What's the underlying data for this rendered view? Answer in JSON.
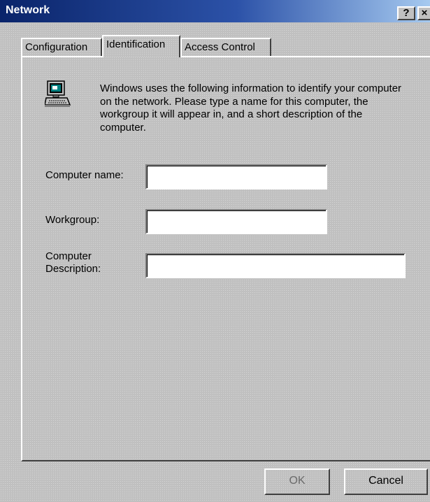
{
  "window": {
    "title": "Network",
    "help_label": "?",
    "close_label": "×"
  },
  "tabs": [
    {
      "label": "Configuration",
      "selected": false
    },
    {
      "label": "Identification",
      "selected": true
    },
    {
      "label": "Access Control",
      "selected": false
    }
  ],
  "identification": {
    "description": "Windows uses the following information to identify your computer on the network.  Please type a name for this computer, the workgroup it will appear in, and a short description of the computer.",
    "icon": "computer-icon",
    "fields": {
      "computer_name": {
        "label": "Computer name:",
        "value": ""
      },
      "workgroup": {
        "label": "Workgroup:",
        "value": ""
      },
      "description_line1": "Computer",
      "description_line2": "Description:",
      "computer_description": {
        "value": ""
      }
    }
  },
  "buttons": {
    "ok": "OK",
    "cancel": "Cancel"
  }
}
